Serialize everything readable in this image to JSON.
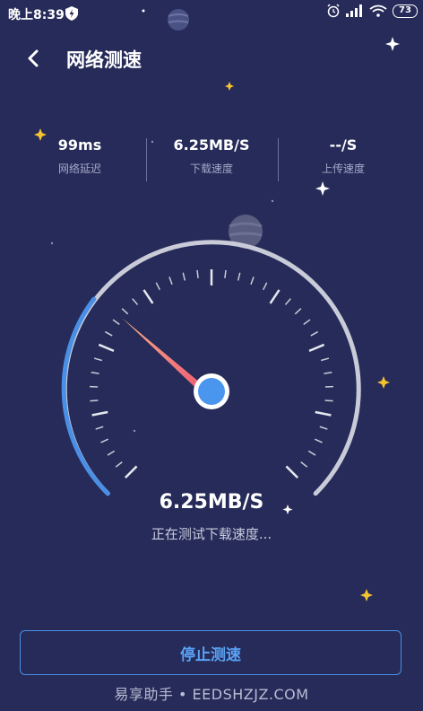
{
  "status_bar": {
    "time": "晚上8:39",
    "battery": "73",
    "icons": [
      "shield-icon",
      "alarm-icon",
      "signal-icon",
      "wifi-icon",
      "battery-icon"
    ]
  },
  "header": {
    "title": "网络测速",
    "back_icon": "chevron-left-icon"
  },
  "stats": [
    {
      "value": "99ms",
      "label": "网络延迟"
    },
    {
      "value": "6.25MB/S",
      "label": "下载速度"
    },
    {
      "value": "--/S",
      "label": "上传速度"
    }
  ],
  "gauge": {
    "current_speed": "6.25MB/S",
    "status_text": "正在测试下载速度...",
    "progress_fraction": 0.19
  },
  "stop_button": {
    "label": "停止测速"
  },
  "watermark": {
    "text": "易享助手 • EEDSHZJZ.COM"
  },
  "colors": {
    "background": "#262b59",
    "accent_blue": "#4a8fe6",
    "needle": "#f26a6a",
    "track": "#c9ccd8"
  }
}
